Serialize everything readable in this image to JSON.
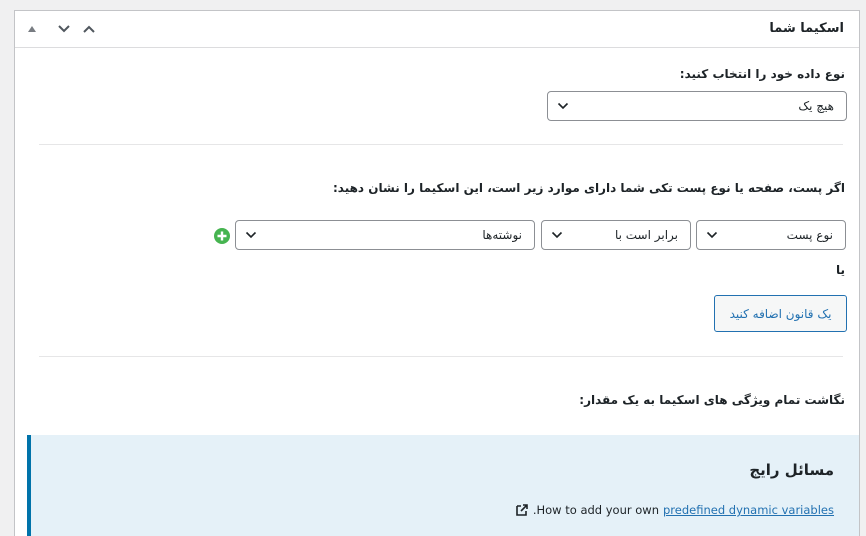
{
  "panel": {
    "title": "اسکیما شما",
    "controls": [
      "collapse-up",
      "move-down",
      "move-up"
    ]
  },
  "data_type": {
    "label": "نوع داده خود را انتخاب کنید:",
    "selected": "هیچ یک"
  },
  "rules": {
    "label": "اگر پست، صفحه یا نوع پست تکی شما دارای موارد زیر است، این اسکیما را نشان دهید:",
    "param": "نوع پست",
    "operator": "برابر است با",
    "value": "نوشته‌ها",
    "or_label": "یا",
    "add_button": "یک قانون اضافه کنید"
  },
  "mapping": {
    "label": "نگاشت تمام ویژگی های اسکیما به یک مقدار:"
  },
  "faq": {
    "title": "مسائل رایج",
    "prefix": "How to add your own",
    "link": "predefined dynamic variables",
    "suffix": "."
  },
  "colors": {
    "accent": "#2271b1",
    "notice_bg": "#e5f1f8",
    "notice_border": "#0073aa",
    "add_green": "#46b450"
  }
}
